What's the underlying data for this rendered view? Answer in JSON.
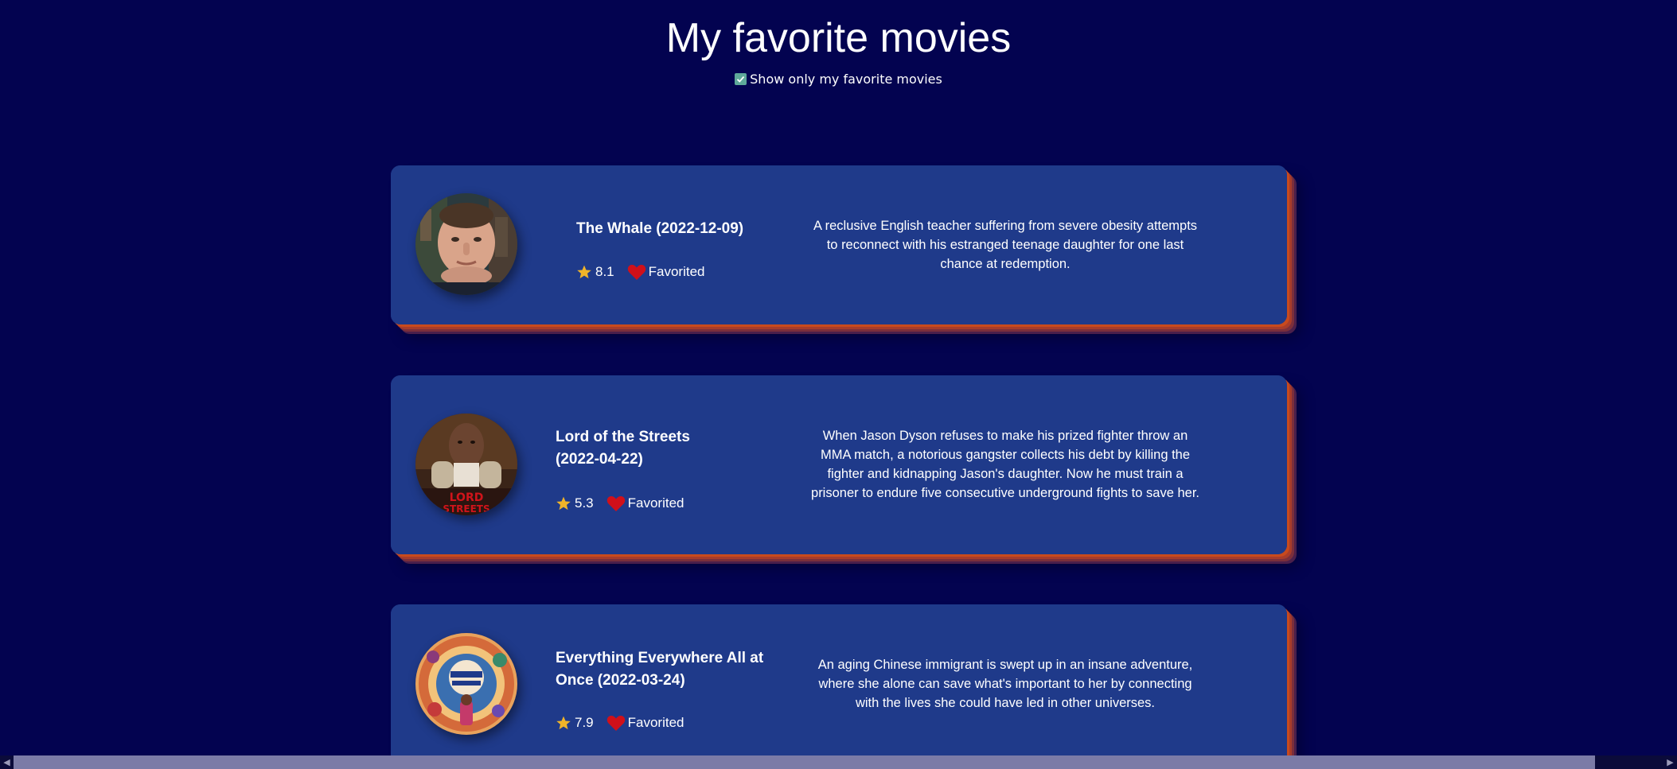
{
  "header": {
    "title": "My favorite movies",
    "filter_label": "Show only my favorite movies",
    "filter_checked": true
  },
  "colors": {
    "background": "#030350",
    "card": "#1f3a8a",
    "card_edge": "#c84a1d",
    "star": "#f0b429",
    "heart": "#d0101a",
    "checkbox": "#5ea99a"
  },
  "movies": [
    {
      "title": "The Whale (2022-12-09)",
      "rating": "8.1",
      "favorite_label": "Favorited",
      "overview": "A reclusive English teacher suffering from severe obesity attempts to reconnect with his estranged teenage daughter for one last chance at redemption.",
      "poster_icon": "poster-the-whale"
    },
    {
      "title": "Lord of the Streets (2022-04-22)",
      "rating": "5.3",
      "favorite_label": "Favorited",
      "overview": "When Jason Dyson refuses to make his prized fighter throw an MMA match, a notorious gangster collects his debt by killing the fighter and kidnapping Jason's daughter. Now he must train a prisoner to endure five consecutive underground fights to save her.",
      "poster_icon": "poster-lord-of-the-streets"
    },
    {
      "title": "Everything Everywhere All at Once (2022-03-24)",
      "rating": "7.9",
      "favorite_label": "Favorited",
      "overview": "An aging Chinese immigrant is swept up in an insane adventure, where she alone can save what's important to her by connecting with the lives she could have led in other universes.",
      "poster_icon": "poster-everything-everywhere"
    }
  ]
}
